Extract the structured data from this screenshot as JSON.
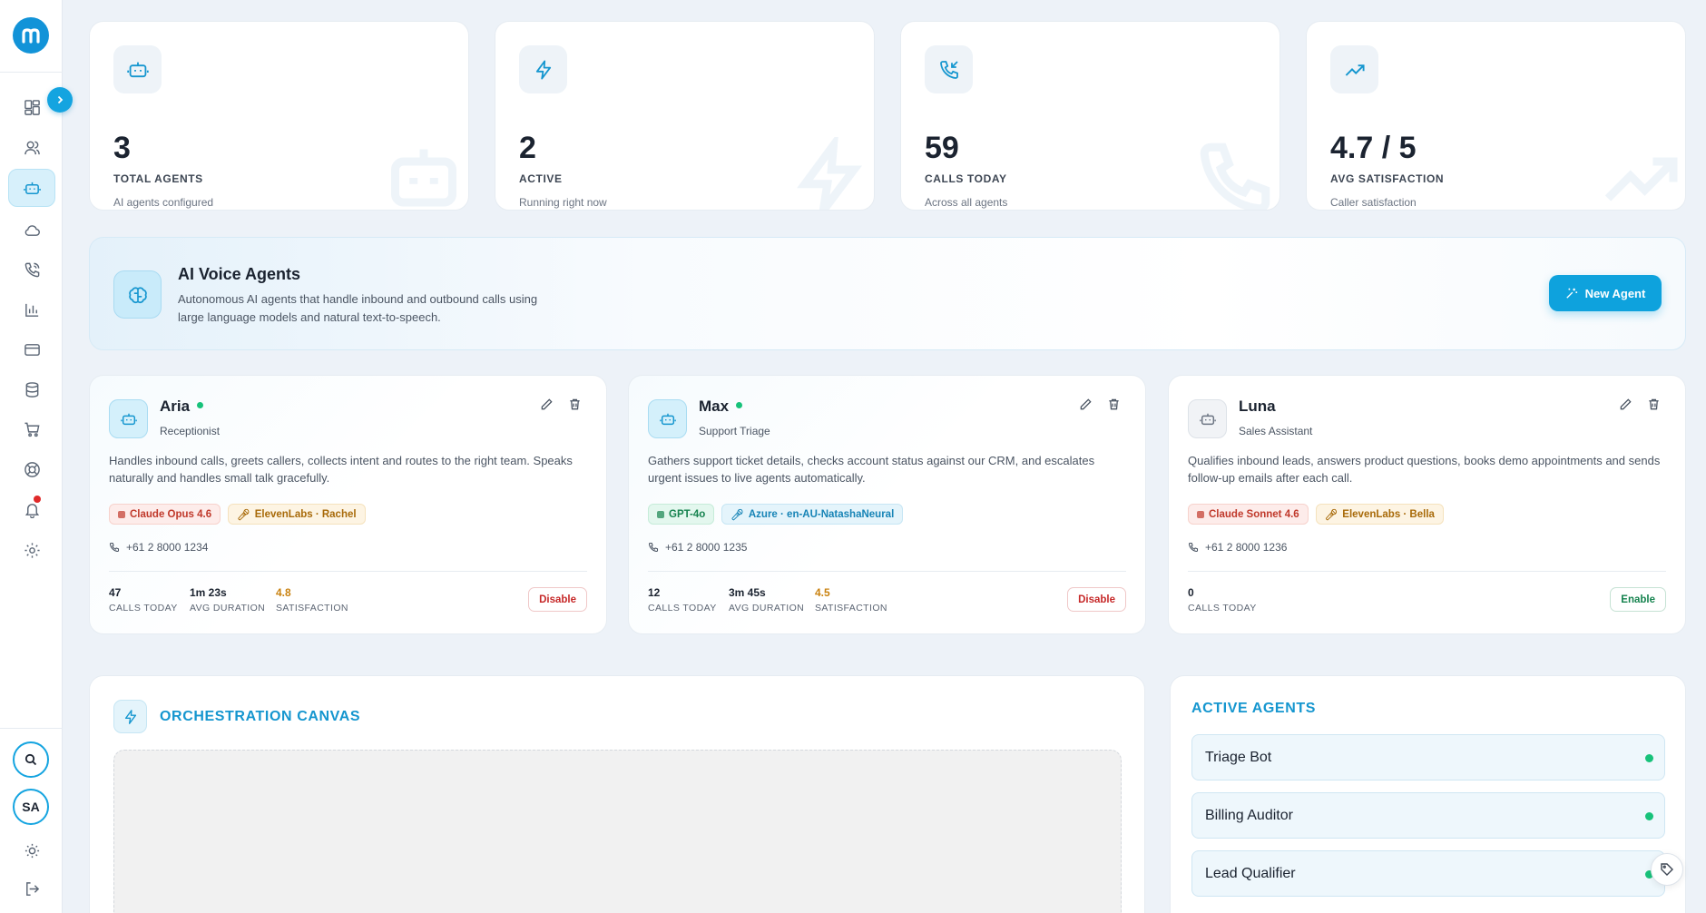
{
  "sidebar": {
    "brand_letter": "m",
    "items": [
      {
        "icon": "dashboard-icon"
      },
      {
        "icon": "users-icon"
      },
      {
        "icon": "robot-icon",
        "active": true
      },
      {
        "icon": "cloud-icon"
      },
      {
        "icon": "phone-icon"
      },
      {
        "icon": "bar-chart-icon"
      },
      {
        "icon": "credit-card-icon"
      },
      {
        "icon": "database-icon"
      },
      {
        "icon": "cart-icon"
      },
      {
        "icon": "support-icon"
      },
      {
        "icon": "bell-icon",
        "has_notification": true
      },
      {
        "icon": "settings-icon"
      }
    ],
    "avatar_initials": "SA"
  },
  "stats": [
    {
      "value": "3",
      "label": "TOTAL AGENTS",
      "sub": "AI agents configured",
      "icon": "robot-icon"
    },
    {
      "value": "2",
      "label": "ACTIVE",
      "sub": "Running right now",
      "icon": "lightning-icon"
    },
    {
      "value": "59",
      "label": "CALLS TODAY",
      "sub": "Across all agents",
      "icon": "phone-incoming-icon"
    },
    {
      "value": "4.7 / 5",
      "label": "AVG SATISFACTION",
      "sub": "Caller satisfaction",
      "icon": "trending-up-icon"
    }
  ],
  "banner": {
    "title": "AI Voice Agents",
    "description": "Autonomous AI agents that handle inbound and outbound calls using large language models and natural text-to-speech.",
    "button_label": "New Agent"
  },
  "agents": [
    {
      "name": "Aria",
      "role": "Receptionist",
      "online": true,
      "description": "Handles inbound calls, greets callers, collects intent and routes to the right team. Speaks naturally and handles small talk gracefully.",
      "model": "Claude Opus 4.6",
      "voice": "ElevenLabs · Rachel",
      "phone": "+61 2 8000 1234",
      "calls_today": "47",
      "calls_today_label": "CALLS TODAY",
      "avg_duration": "1m 23s",
      "avg_duration_label": "AVG DURATION",
      "satisfaction": "4.8",
      "satisfaction_label": "SATISFACTION",
      "toggle_label": "Disable"
    },
    {
      "name": "Max",
      "role": "Support Triage",
      "online": true,
      "description": "Gathers support ticket details, checks account status against our CRM, and escalates urgent issues to live agents automatically.",
      "model": "GPT-4o",
      "voice": "Azure · en-AU-NatashaNeural",
      "phone": "+61 2 8000 1235",
      "calls_today": "12",
      "calls_today_label": "CALLS TODAY",
      "avg_duration": "3m 45s",
      "avg_duration_label": "AVG DURATION",
      "satisfaction": "4.5",
      "satisfaction_label": "SATISFACTION",
      "toggle_label": "Disable"
    },
    {
      "name": "Luna",
      "role": "Sales Assistant",
      "online": false,
      "description": "Qualifies inbound leads, answers product questions, books demo appointments and sends follow-up emails after each call.",
      "model": "Claude Sonnet 4.6",
      "voice": "ElevenLabs · Bella",
      "phone": "+61 2 8000 1236",
      "calls_today": "0",
      "calls_today_label": "CALLS TODAY",
      "toggle_label": "Enable"
    }
  ],
  "orchestration": {
    "title": "ORCHESTRATION CANVAS"
  },
  "active_agents": {
    "title": "ACTIVE AGENTS",
    "items": [
      "Triage Bot",
      "Billing Auditor",
      "Lead Qualifier"
    ]
  },
  "colors": {
    "accent": "#1596cf",
    "brand": "#1293d8",
    "online": "#17c27a",
    "danger": "#c62828"
  }
}
